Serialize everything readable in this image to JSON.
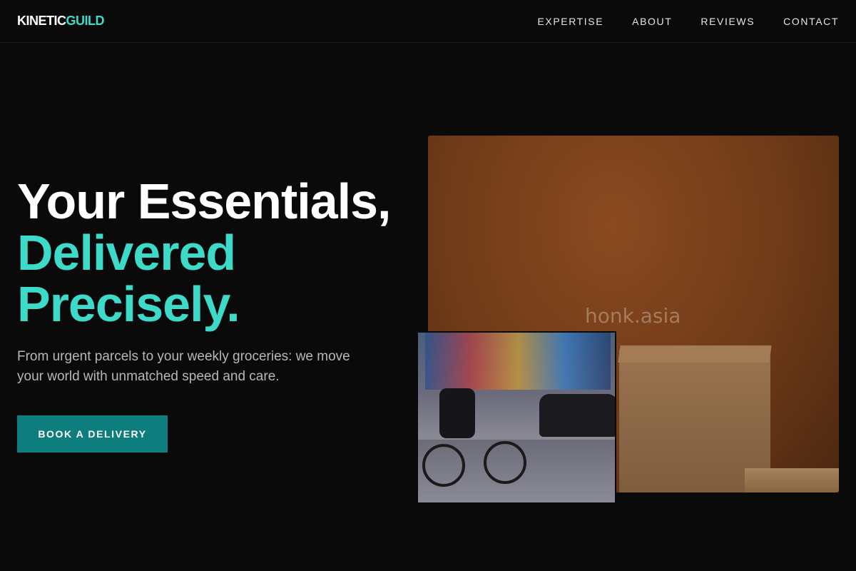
{
  "brand": {
    "part1": "KINETIC",
    "part2": "GUILD",
    "accent_color": "#3dd9c9"
  },
  "nav": {
    "items": [
      {
        "label": "EXPERTISE"
      },
      {
        "label": "ABOUT"
      },
      {
        "label": "REVIEWS"
      },
      {
        "label": "CONTACT"
      }
    ]
  },
  "hero": {
    "title_line1": "Your Essentials,",
    "title_line2": "Delivered",
    "title_line3": "Precisely.",
    "subtitle": "From urgent parcels to your weekly groceries: we move your world with unmatched speed and care.",
    "cta_label": "BOOK A DELIVERY",
    "cta_color": "#0d7d7d"
  },
  "images": {
    "main_watermark": "honk.asia"
  },
  "colors": {
    "background": "#0a0a0a",
    "accent": "#3dd9c9"
  }
}
